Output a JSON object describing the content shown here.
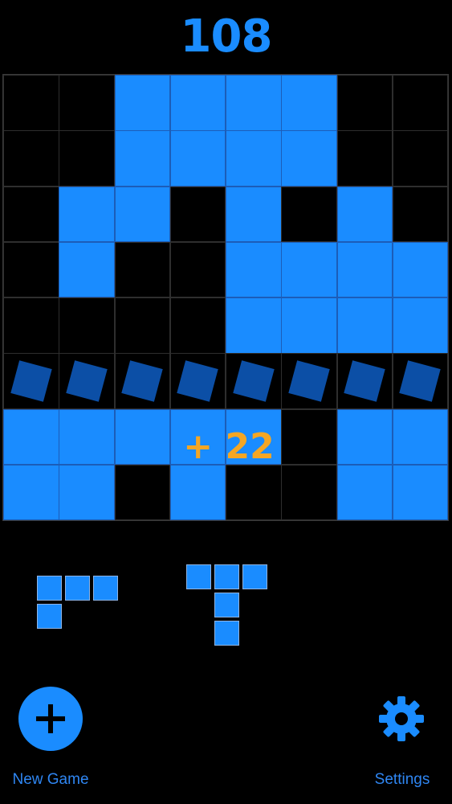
{
  "theme": {
    "background": "#000000",
    "accent": "#1a8cff",
    "grid_line": "#2e2e2e",
    "clearing_tile": "#0c4fa6",
    "bonus": "#f5a623",
    "label": "#2f86f2"
  },
  "score": "108",
  "bonus_text": "+ 22",
  "board": {
    "rows": [
      [
        0,
        0,
        1,
        1,
        1,
        1,
        0,
        0
      ],
      [
        0,
        0,
        1,
        1,
        1,
        1,
        0,
        0
      ],
      [
        0,
        1,
        1,
        0,
        1,
        0,
        1,
        0
      ],
      [
        0,
        1,
        0,
        0,
        1,
        1,
        1,
        1
      ],
      [
        0,
        0,
        0,
        0,
        1,
        1,
        1,
        1
      ],
      [
        2,
        2,
        2,
        2,
        2,
        2,
        2,
        2
      ],
      [
        1,
        1,
        1,
        1,
        1,
        0,
        1,
        1
      ],
      [
        1,
        1,
        0,
        1,
        0,
        0,
        1,
        1
      ]
    ],
    "legend": {
      "0": "empty",
      "1": "filled",
      "2": "clearing"
    }
  },
  "pieces": [
    {
      "cells": [
        [
          0,
          0
        ],
        [
          0,
          1
        ],
        [
          0,
          2
        ],
        [
          1,
          0
        ]
      ]
    },
    {
      "cells": [
        [
          0,
          0
        ],
        [
          0,
          1
        ],
        [
          0,
          2
        ],
        [
          1,
          1
        ],
        [
          2,
          1
        ]
      ]
    }
  ],
  "controls": {
    "new_game_label": "New Game",
    "new_game_icon": "plus-icon",
    "settings_label": "Settings",
    "settings_icon": "gear-icon"
  }
}
